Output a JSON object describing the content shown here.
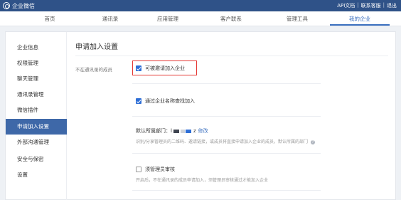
{
  "topbar": {
    "app_name": "企业微信",
    "links": [
      "API文档",
      "联系客服",
      "退出"
    ],
    "colors": {
      "bar": "#2f5288",
      "accent": "#3a6fbf"
    }
  },
  "nav": {
    "tabs": [
      {
        "label": "首页",
        "active": false
      },
      {
        "label": "通讯录",
        "active": false
      },
      {
        "label": "应用管理",
        "active": false
      },
      {
        "label": "客户联系",
        "active": false
      },
      {
        "label": "管理工具",
        "active": false
      },
      {
        "label": "我的企业",
        "active": true
      }
    ]
  },
  "sidebar": {
    "items": [
      {
        "label": "企业信息",
        "active": false
      },
      {
        "label": "权限管理",
        "active": false
      },
      {
        "label": "聊天管理",
        "active": false
      },
      {
        "label": "通讯录管理",
        "active": false
      },
      {
        "label": "微信插件",
        "active": false
      },
      {
        "label": "申请加入设置",
        "active": true
      },
      {
        "label": "外部沟通管理",
        "active": false
      },
      {
        "label": "安全与保密",
        "active": false
      },
      {
        "label": "设置",
        "active": false
      }
    ]
  },
  "main": {
    "title": "申请加入设置",
    "section_label": "不在通讯录的成员",
    "option_invite": {
      "label": "可被邀请加入企业",
      "checked": true
    },
    "option_search": {
      "label": "通过企业名称查找加入",
      "checked": true
    },
    "dept": {
      "label_prefix": "默认所属部门：",
      "name_fragment": "l",
      "name_suffix": "z",
      "edit_label": "修改",
      "description": "识别/分享管理员的二维码、邀请链接，或成员将直接申请加入企业的成员，默认所属的部门"
    },
    "option_review": {
      "label": "须管理员审核",
      "checked": false,
      "description": "开启后，不在通讯录的成员申请加入，须管理员审核通过才能加入企业"
    }
  }
}
